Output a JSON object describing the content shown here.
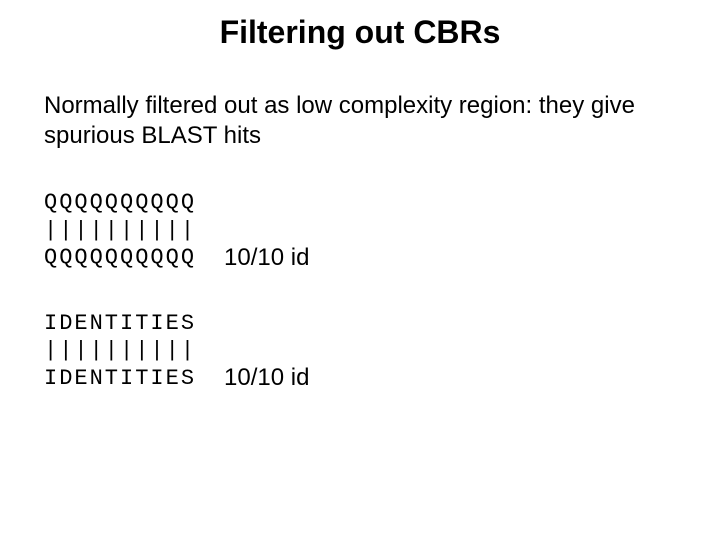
{
  "title": "Filtering out CBRs",
  "subtitle": "Normally filtered out as low complexity region: they give spurious BLAST hits",
  "alignments": [
    {
      "seq1": "QQQQQQQQQQ",
      "match": "||||||||||",
      "seq2": "QQQQQQQQQQ",
      "score": "10/10 id"
    },
    {
      "seq1": "IDENTITIES",
      "match": "||||||||||",
      "seq2": "IDENTITIES",
      "score": "10/10 id"
    }
  ]
}
